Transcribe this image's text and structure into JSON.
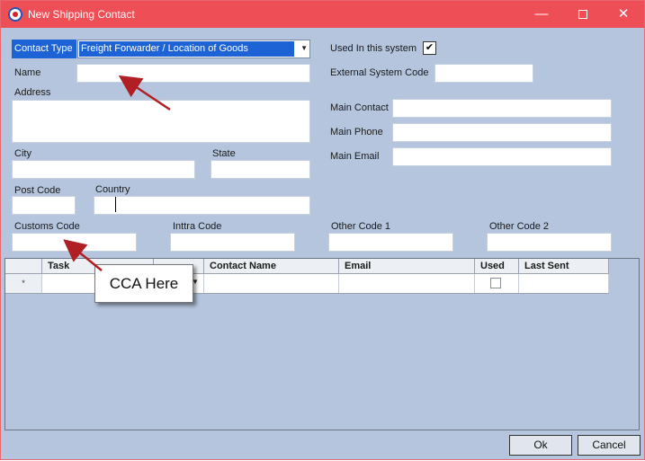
{
  "window": {
    "title": "New Shipping Contact",
    "controls": {
      "minimize": "—",
      "maximize": "",
      "close": "✕"
    }
  },
  "form": {
    "contact_type_label": "Contact Type",
    "contact_type_value": "Freight Forwarder / Location of Goods",
    "used_in_system_label": "Used In this system",
    "used_in_system_checked": "✔",
    "name_label": "Name",
    "name_value": "",
    "external_code_label": "External System Code",
    "external_code_value": "",
    "address_label": "Address",
    "address_value": "",
    "main_contact_label": "Main Contact",
    "main_contact_value": "",
    "main_phone_label": "Main Phone",
    "main_phone_value": "",
    "main_email_label": "Main Email",
    "main_email_value": "",
    "city_label": "City",
    "city_value": "",
    "state_label": "State",
    "state_value": "",
    "post_code_label": "Post Code",
    "post_code_value": "",
    "country_label": "Country",
    "country_value": "",
    "customs_code_label": "Customs Code",
    "customs_code_value": "",
    "intra_code_label": "Inttra Code",
    "intra_code_value": "",
    "other1_label": "Other Code 1",
    "other1_value": "",
    "other2_label": "Other Code 2",
    "other2_value": ""
  },
  "grid": {
    "columns": [
      "Task",
      "",
      "Contact Name",
      "Email",
      "Used",
      "Last Sent"
    ],
    "new_row_marker": "*"
  },
  "annotation": {
    "callout_text": "CCA Here",
    "arrow_color": "#b01f24"
  },
  "buttons": {
    "ok": "Ok",
    "cancel": "Cancel"
  }
}
